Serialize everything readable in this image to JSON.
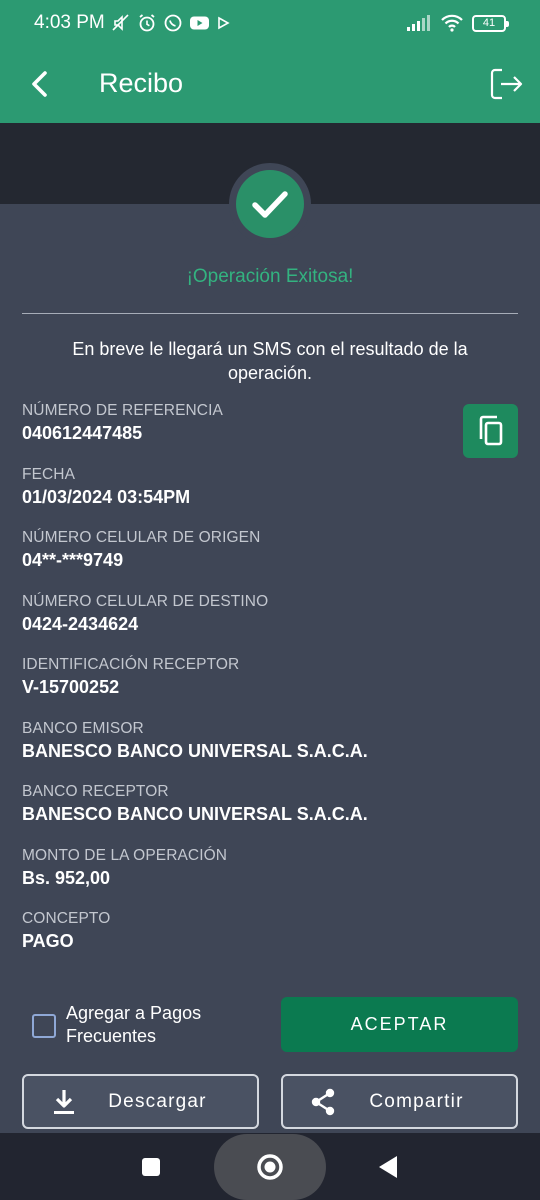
{
  "status_bar": {
    "time": "4:03 PM",
    "battery": "41",
    "icons": [
      "mute-icon",
      "alarm-icon",
      "whatsapp-icon",
      "youtube-icon",
      "play-icon",
      "signal-icon",
      "wifi-icon",
      "battery-icon"
    ]
  },
  "app_bar": {
    "title": "Recibo",
    "back_icon": "chevron-left-icon",
    "logout_icon": "logout-icon"
  },
  "receipt": {
    "success_text": "¡Operación Exitosa!",
    "sms_message": "En breve le llegará un SMS con el resultado de la operación.",
    "fields": [
      {
        "label": "NÚMERO DE REFERENCIA",
        "value": "040612447485"
      },
      {
        "label": "FECHA",
        "value": "01/03/2024 03:54PM"
      },
      {
        "label": "NÚMERO CELULAR DE ORIGEN",
        "value": "04**-***9749"
      },
      {
        "label": "NÚMERO CELULAR DE DESTINO",
        "value": "0424-2434624"
      },
      {
        "label": "IDENTIFICACIÓN RECEPTOR",
        "value": "V-15700252"
      },
      {
        "label": "BANCO EMISOR",
        "value": "BANESCO BANCO UNIVERSAL S.A.C.A."
      },
      {
        "label": "BANCO RECEPTOR",
        "value": "BANESCO BANCO UNIVERSAL S.A.C.A."
      },
      {
        "label": "MONTO DE LA OPERACIÓN",
        "value": "Bs. 952,00"
      },
      {
        "label": "CONCEPTO",
        "value": "PAGO"
      }
    ]
  },
  "actions": {
    "favorites_label": "Agregar a Pagos Frecuentes",
    "favorites_checked": false,
    "accept_label": "ACEPTAR",
    "download_label": "Descargar",
    "share_label": "Compartir"
  },
  "colors": {
    "brand_green": "#2c9a72",
    "success_text": "#33b380",
    "accept_button": "#0b7a50",
    "background": "#3f4656"
  }
}
